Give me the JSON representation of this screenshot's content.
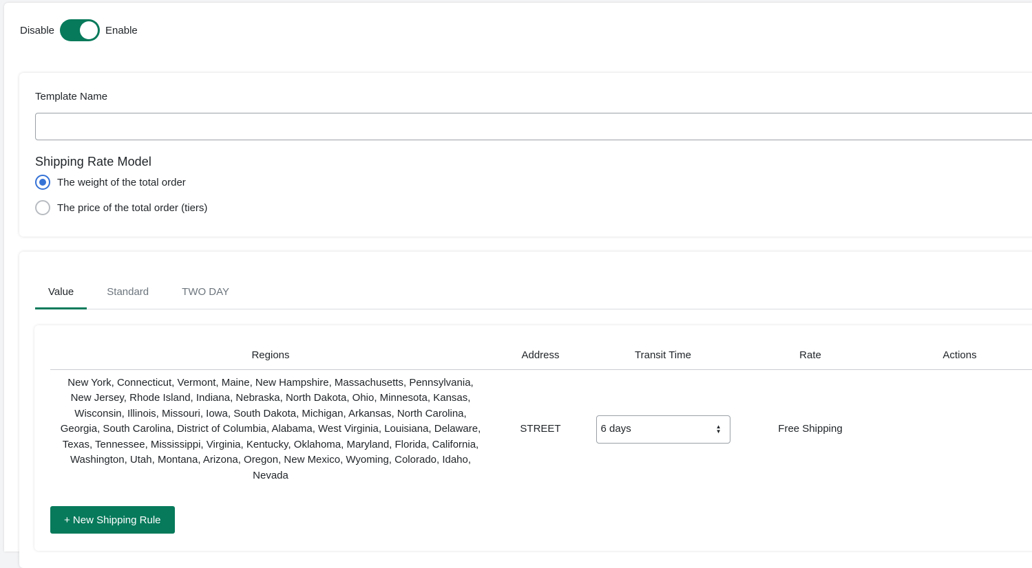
{
  "toggle": {
    "disable_label": "Disable",
    "enable_label": "Enable",
    "state": "enabled",
    "accent_color": "#077a5b"
  },
  "template": {
    "name_label": "Template Name",
    "name_value": ""
  },
  "rate_model": {
    "title": "Shipping Rate Model",
    "options": [
      {
        "label": "The weight of the total order",
        "checked": true
      },
      {
        "label": "The price of the total order (tiers)",
        "checked": false
      }
    ]
  },
  "tabs": [
    {
      "label": "Value",
      "active": true
    },
    {
      "label": "Standard",
      "active": false
    },
    {
      "label": "TWO DAY",
      "active": false
    }
  ],
  "table": {
    "headers": {
      "regions": "Regions",
      "address": "Address",
      "transit_time": "Transit Time",
      "rate": "Rate",
      "actions": "Actions"
    },
    "rows": [
      {
        "regions": "New York, Connecticut, Vermont, Maine, New Hampshire, Massachusetts, Pennsylvania, New Jersey, Rhode Island, Indiana, Nebraska, North Dakota, Ohio, Minnesota, Kansas, Wisconsin, Illinois, Missouri, Iowa, South Dakota, Michigan, Arkansas, North Carolina, Georgia, South Carolina, District of Columbia, Alabama, West Virginia, Louisiana, Delaware, Texas, Tennessee, Mississippi, Virginia, Kentucky, Oklahoma, Maryland, Florida, California, Washington, Utah, Montana, Arizona, Oregon, New Mexico, Wyoming, Colorado, Idaho, Nevada",
        "address": "STREET",
        "transit_time": "6 days",
        "rate": "Free Shipping"
      }
    ]
  },
  "new_rule_button": "+ New Shipping Rule"
}
